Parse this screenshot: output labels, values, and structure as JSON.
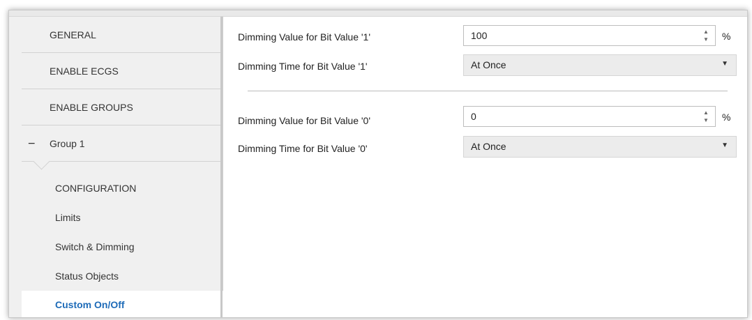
{
  "sidebar": {
    "items": [
      {
        "label": "GENERAL"
      },
      {
        "label": "ENABLE ECGS"
      },
      {
        "label": "ENABLE GROUPS"
      }
    ],
    "group": {
      "toggle": "−",
      "label": "Group 1"
    },
    "subitems": [
      {
        "label": "CONFIGURATION"
      },
      {
        "label": "Limits"
      },
      {
        "label": "Switch & Dimming"
      },
      {
        "label": "Status Objects"
      },
      {
        "label": "Custom On/Off",
        "active": true
      }
    ]
  },
  "main": {
    "bit1": {
      "value_label": "Dimming Value for Bit Value '1'",
      "value": "100",
      "unit": "%",
      "time_label": "Dimming Time for Bit Value '1'",
      "time_value": "At Once"
    },
    "bit0": {
      "value_label": "Dimming Value for Bit Value '0'",
      "value": "0",
      "unit": "%",
      "time_label": "Dimming Time for Bit Value '0'",
      "time_value": "At Once"
    },
    "spin_up_icon": "triangle-up",
    "spin_down_icon": "triangle-down",
    "dropdown_icon": "caret-down"
  },
  "colors": {
    "active_link": "#1e6bb8",
    "sidebar_bg": "#f0f0f0",
    "select_bg": "#ececec"
  }
}
